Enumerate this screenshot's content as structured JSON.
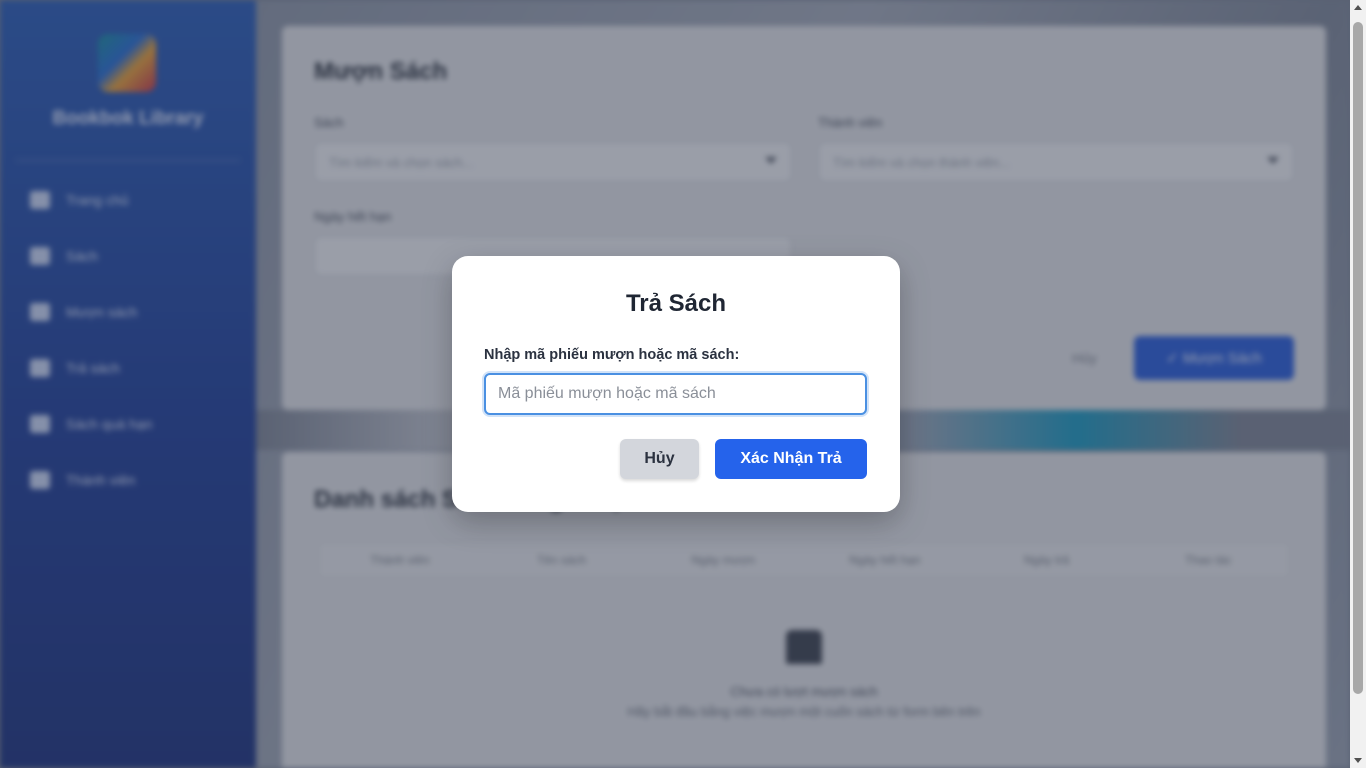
{
  "sidebar": {
    "brand": "Bookbok Library",
    "items": [
      {
        "label": "Trang chủ",
        "icon": "home-icon"
      },
      {
        "label": "Sách",
        "icon": "book-icon"
      },
      {
        "label": "Mượn sách",
        "icon": "borrow-icon"
      },
      {
        "label": "Trả sách",
        "icon": "return-icon"
      },
      {
        "label": "Sách quá hạn",
        "icon": "warning-icon"
      },
      {
        "label": "Thành viên",
        "icon": "users-icon"
      }
    ]
  },
  "borrow_form": {
    "title": "Mượn Sách",
    "book_label": "Sách",
    "book_placeholder": "Tìm kiếm và chọn sách...",
    "member_label": "Thành viên",
    "member_placeholder": "Tìm kiếm và chọn thành viên...",
    "due_label": "Ngày hết hạn",
    "cancel_label": "Hủy",
    "submit_label": "✓ Mượn Sách"
  },
  "borrow_list": {
    "title": "Danh sách Sách đang mượn",
    "columns": [
      "Thành viên",
      "Tên sách",
      "Ngày mượn",
      "Ngày hết hạn",
      "Ngày trả",
      "Thao tác"
    ],
    "empty_title": "Chưa có lượt mượn sách",
    "empty_hint": "Hãy bắt đầu bằng việc mượn một cuốn sách từ form bên trên"
  },
  "modal": {
    "title": "Trả Sách",
    "label": "Nhập mã phiếu mượn hoặc mã sách:",
    "input_placeholder": "Mã phiếu mượn hoặc mã sách",
    "input_value": "",
    "cancel_label": "Hủy",
    "confirm_label": "Xác Nhận Trả"
  },
  "colors": {
    "primary": "#2563eb",
    "sidebar_top": "#2d5fb8",
    "sidebar_bottom": "#1f3580",
    "focus_ring": "#4a90e2"
  }
}
